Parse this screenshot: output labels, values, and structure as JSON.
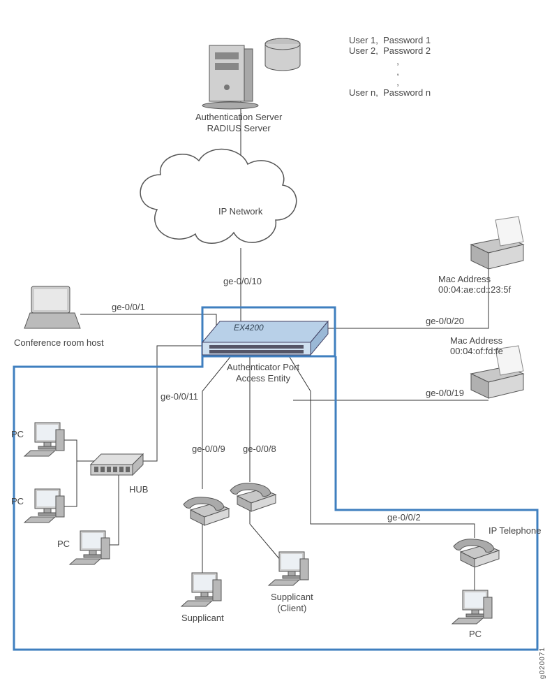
{
  "labels": {
    "auth_server_line1": "Authentication Server",
    "auth_server_line2": "RADIUS Server",
    "ip_network": "IP Network",
    "switch_model": "EX4200",
    "auth_port_line1": "Authenticator Port",
    "auth_port_line2": "Access Entity",
    "conf_room": "Conference room host",
    "mac1_label": "Mac Address",
    "mac1_value": "00:04:ae:cd::23:5f",
    "mac2_label": "Mac Address",
    "mac2_value": "00:04:of:fd:fe",
    "hub": "HUB",
    "supplicant1": "Supplicant",
    "supplicant_client_line1": "Supplicant",
    "supplicant_client_line2": "(Client)",
    "ip_telephone": "IP Telephone",
    "pc": "PC",
    "pc_lower": "PC",
    "pc_left1": "PC",
    "pc_left2": "PC",
    "pc_left3": "PC",
    "user_list": {
      "u1": "User 1,",
      "p1": "Password 1",
      "u2": "User 2,",
      "p2": "Password 2",
      "un": "User n,",
      "pn": "Password n",
      "comma": ","
    },
    "image_id": "g020071"
  },
  "ports": {
    "ge_0_0_1": "ge-0/0/1",
    "ge_0_0_10": "ge-0/0/10",
    "ge_0_0_20": "ge-0/0/20",
    "ge_0_0_19": "ge-0/0/19",
    "ge_0_0_11": "ge-0/0/11",
    "ge_0_0_9": "ge-0/0/9",
    "ge_0_0_8": "ge-0/0/8",
    "ge_0_0_2": "ge-0/0/2"
  }
}
